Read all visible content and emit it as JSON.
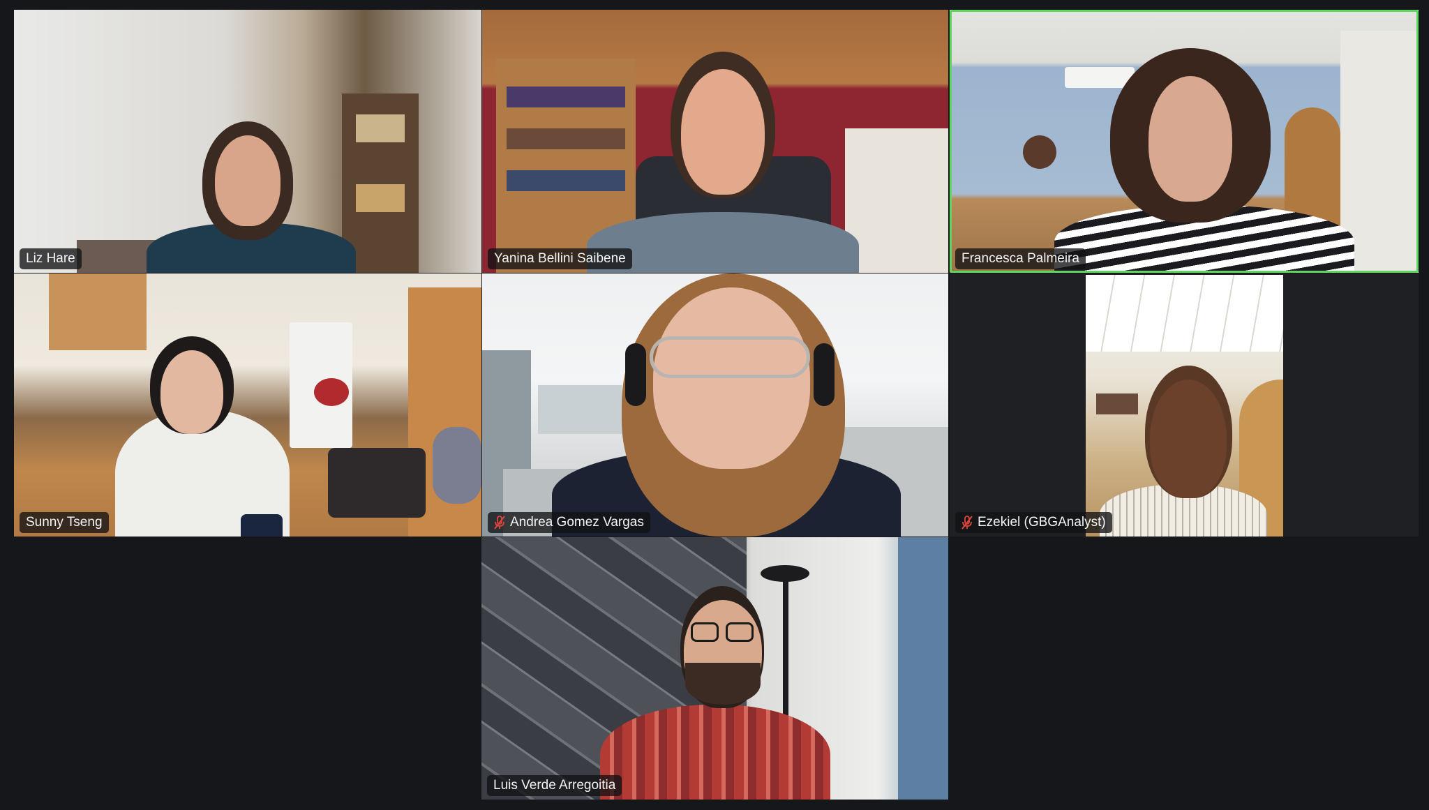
{
  "meeting": {
    "participants": [
      {
        "name": "Liz Hare",
        "muted": false,
        "active_speaker": false
      },
      {
        "name": "Yanina Bellini Saibene",
        "muted": false,
        "active_speaker": false
      },
      {
        "name": "Francesca Palmeira",
        "muted": false,
        "active_speaker": true
      },
      {
        "name": "Sunny Tseng",
        "muted": false,
        "active_speaker": false
      },
      {
        "name": "Andrea Gomez Vargas",
        "muted": true,
        "active_speaker": false
      },
      {
        "name": "Ezekiel (GBGAnalyst)",
        "muted": true,
        "active_speaker": false
      },
      {
        "name": "Luis Verde Arregoitia",
        "muted": false,
        "active_speaker": false
      }
    ]
  },
  "colors": {
    "background": "#16171b",
    "active_speaker_border": "#5cd85c",
    "muted_icon": "#e0463c"
  }
}
